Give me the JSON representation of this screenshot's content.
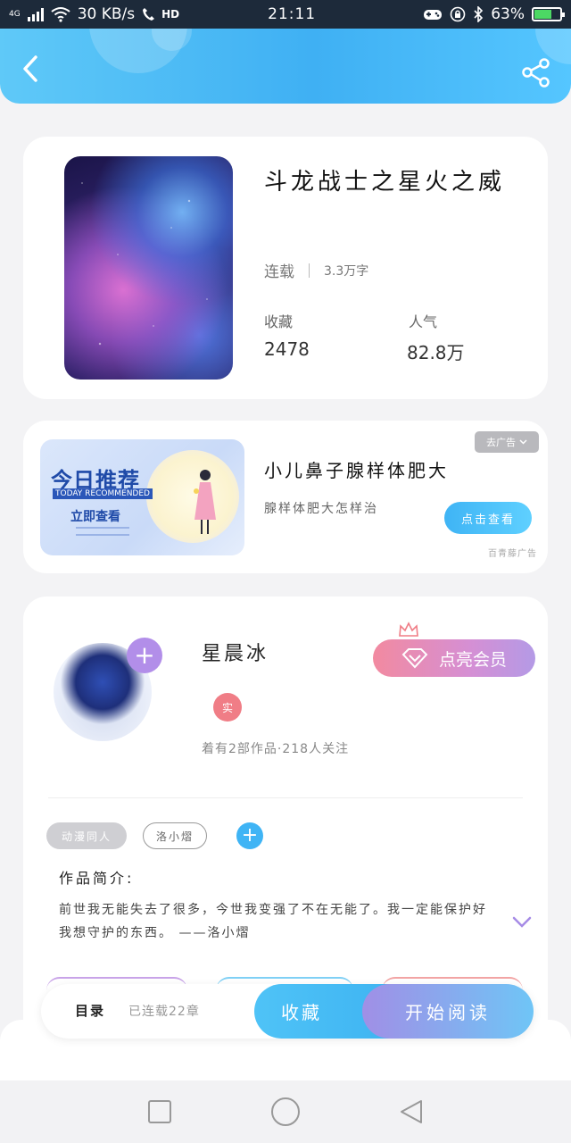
{
  "status_bar": {
    "network_label": "4G",
    "speed": "30 KB/s",
    "hd_label": "HD",
    "time": "21:11",
    "battery": "63%",
    "battery_level": 0.63
  },
  "book": {
    "title": "斗龙战士之星火之威",
    "status": "连载",
    "word_count": "3.3万字",
    "collect_label": "收藏",
    "collect_value": "2478",
    "popularity_label": "人气",
    "popularity_value": "82.8万"
  },
  "ad": {
    "image_headline": "今日推荐",
    "image_sub": "TODAY RECOMMENDED",
    "image_cta": "立即查看",
    "tag": "去广告",
    "title": "小儿鼻子腺样体肥大",
    "description": "腺样体肥大怎样治",
    "button": "点击查看",
    "source": "百青藤广告"
  },
  "author": {
    "name": "星晨冰",
    "badge": "实",
    "meta": "着有2部作品·218人关注",
    "vip_button": "点亮会员",
    "tags": [
      "动漫同人",
      "洛小熠"
    ],
    "intro_label": "作品简介:",
    "intro_text": "前世我无能失去了很多，今世我变强了不在无能了。我一定能保护好我想守护的东西。 ——洛小熠"
  },
  "action_bar": {
    "toc_label": "目录",
    "toc_count": "已连载22章",
    "collect_button": "收藏",
    "read_button": "开始阅读"
  },
  "colors": {
    "accent_blue": "#3fb4f5",
    "vip_pink": "#f28aa0",
    "purple": "#b28ee9"
  }
}
